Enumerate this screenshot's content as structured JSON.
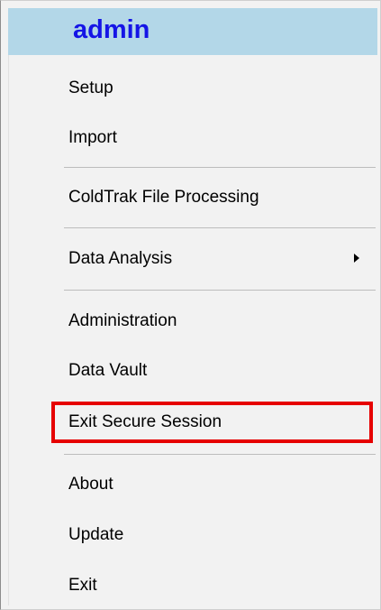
{
  "menu": {
    "header": "admin",
    "items": [
      {
        "label": "Setup"
      },
      {
        "label": "Import"
      },
      {
        "label": "ColdTrak File Processing"
      },
      {
        "label": "Data Analysis",
        "has_submenu": true,
        "submenu_icon": "chevron-right-icon"
      },
      {
        "label": "Administration"
      },
      {
        "label": "Data Vault"
      },
      {
        "label": "Exit Secure Session",
        "highlighted": true
      },
      {
        "label": "About"
      },
      {
        "label": "Update"
      },
      {
        "label": "Exit"
      }
    ]
  },
  "colors": {
    "header_background": "#b3d7e8",
    "header_text": "#1515e6",
    "menu_background": "#f2f2f2",
    "highlight_border": "#e60000"
  }
}
